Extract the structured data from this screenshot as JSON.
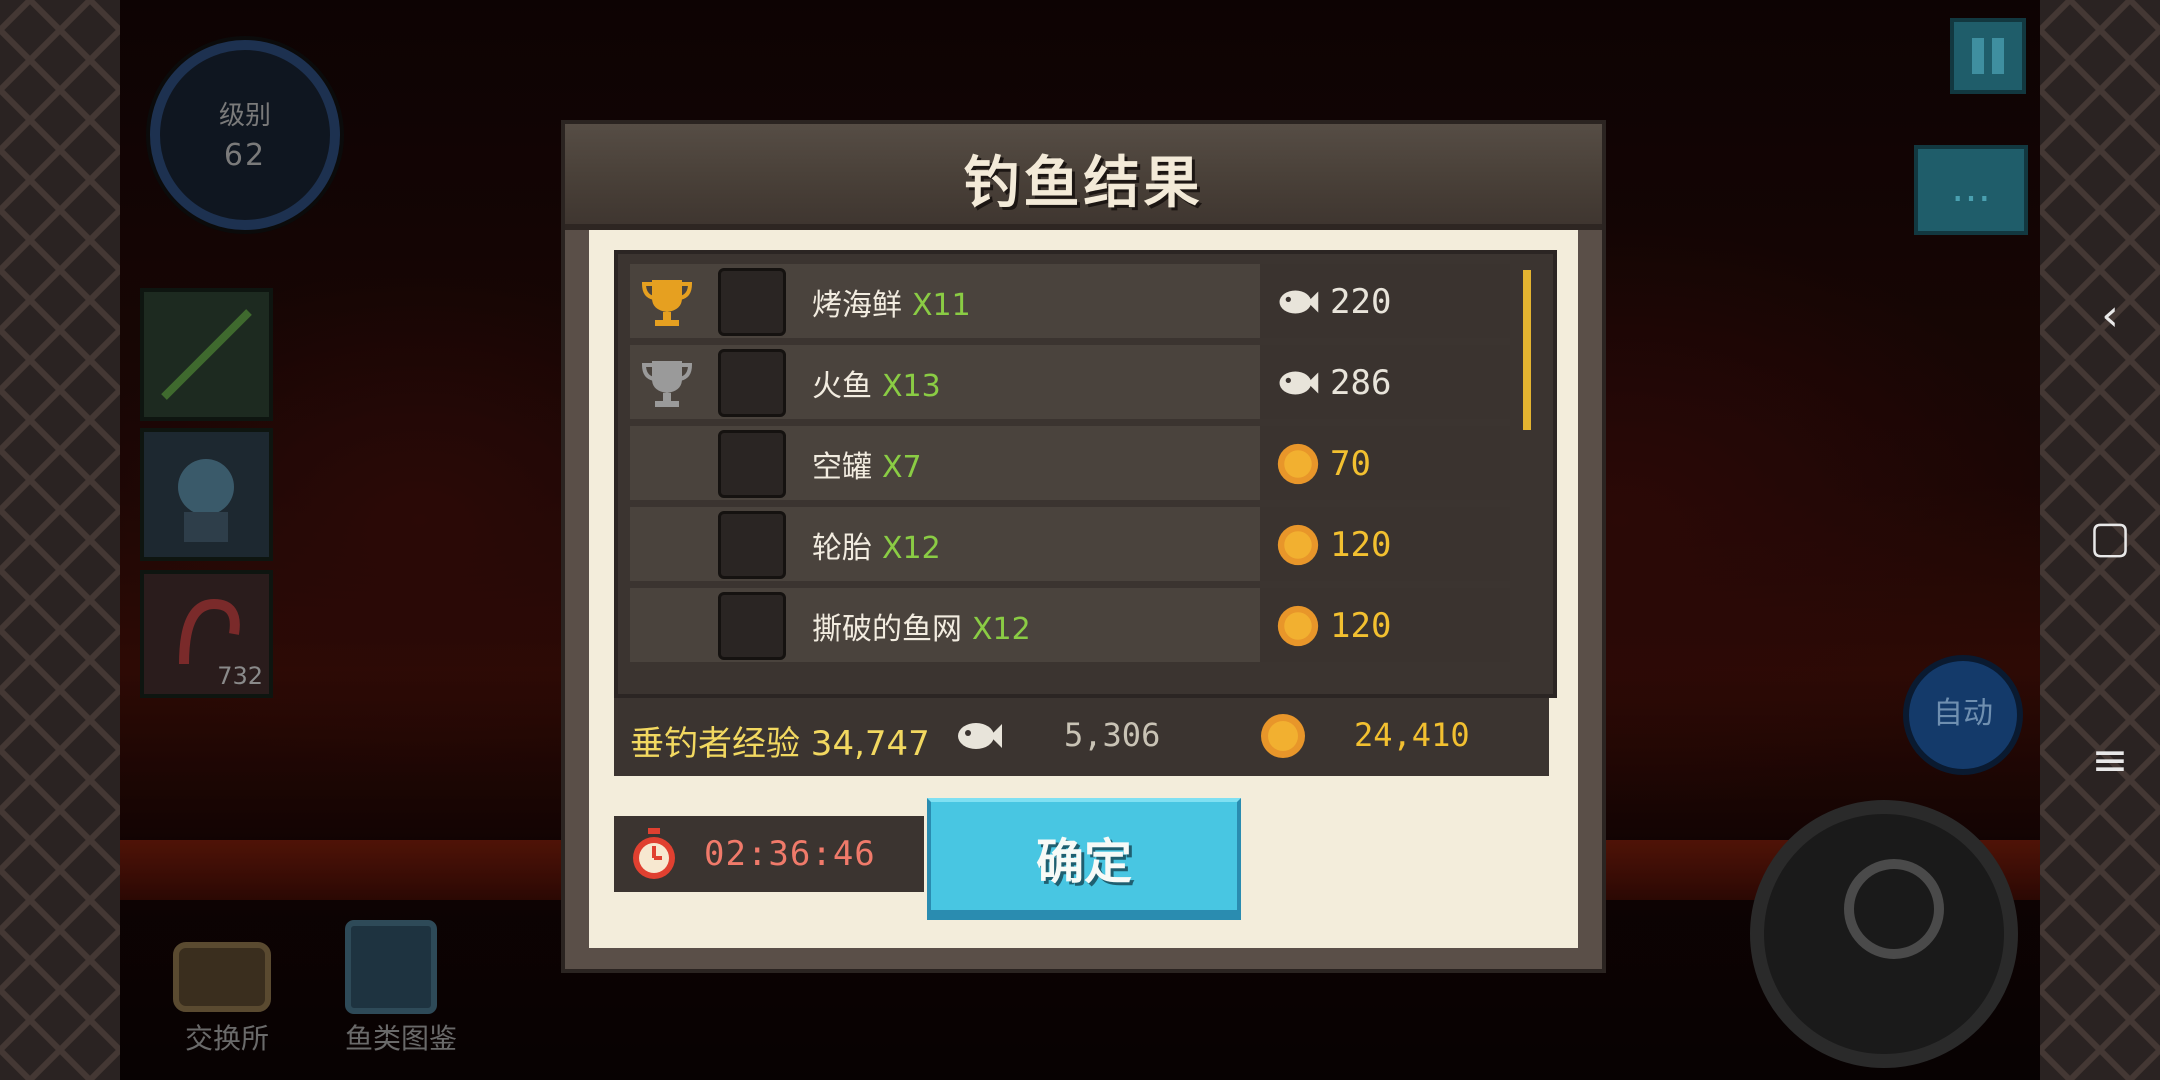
{
  "hud": {
    "level_label": "级别",
    "level_value": "62",
    "bait_count": "732",
    "exchange_label": "交换所",
    "fish_guide_label": "鱼类图鉴",
    "auto_label": "自动"
  },
  "dialog": {
    "title": "钓鱼结果",
    "rows": [
      {
        "name": "烤海鲜",
        "qty": "X11",
        "trophy": "gold",
        "icon": "grilled-seafood-icon",
        "reward_type": "fish",
        "reward": "220"
      },
      {
        "name": "火鱼",
        "qty": "X13",
        "trophy": "silver",
        "icon": "fire-fish-icon",
        "reward_type": "fish",
        "reward": "286"
      },
      {
        "name": "空罐",
        "qty": "X7",
        "trophy": "",
        "icon": "empty-can-icon",
        "reward_type": "coin",
        "reward": "70"
      },
      {
        "name": "轮胎",
        "qty": "X12",
        "trophy": "",
        "icon": "tire-icon",
        "reward_type": "coin",
        "reward": "120"
      },
      {
        "name": "撕破的鱼网",
        "qty": "X12",
        "trophy": "",
        "icon": "torn-net-icon",
        "reward_type": "coin",
        "reward": "120"
      }
    ],
    "summary": {
      "exp_label": "垂钓者经验 34,747",
      "fish_total": "5,306",
      "coin_total": "24,410"
    },
    "timer": "02:36:46",
    "confirm_label": "确定"
  },
  "colors": {
    "confirm": "#48c6e2",
    "qty_green": "#8acc44",
    "coin_gold": "#f2c030",
    "timer_red": "#f07a6a"
  }
}
